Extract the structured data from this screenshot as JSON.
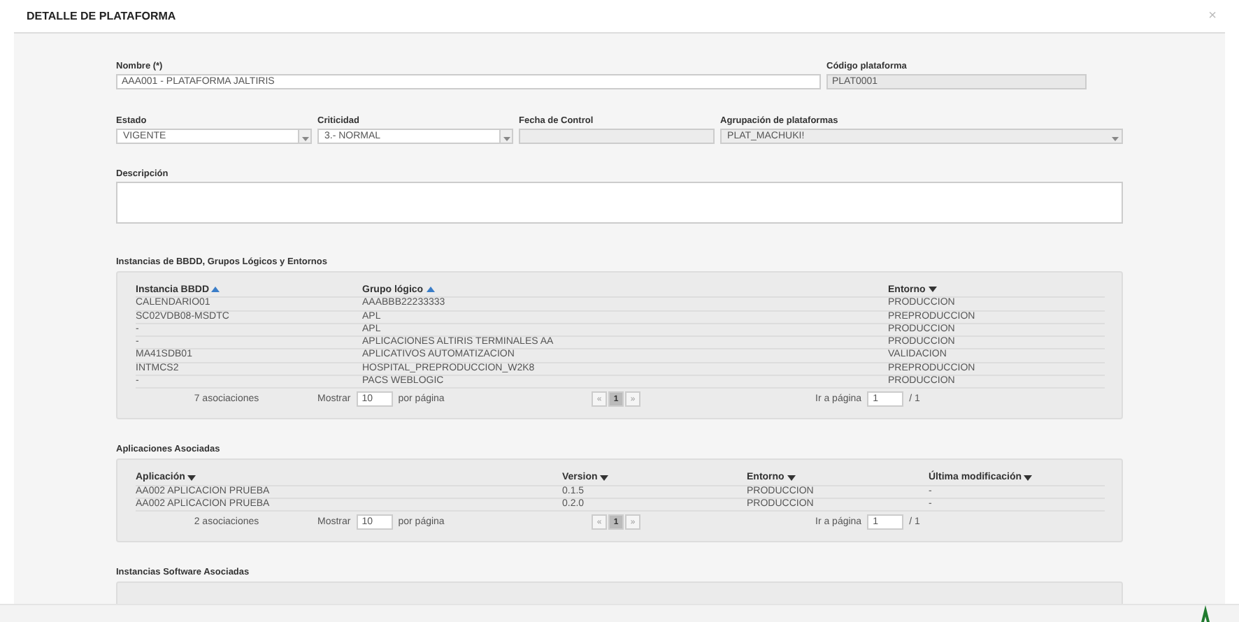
{
  "window": {
    "title": "DETALLE DE PLATAFORMA",
    "close": "×"
  },
  "form": {
    "nombre": {
      "label": "Nombre (*)",
      "value": "AAA001 - PLATAFORMA JALTIRIS"
    },
    "codigo": {
      "label": "Código plataforma",
      "value": "PLAT0001",
      "disabled": true
    },
    "selects": [
      {
        "label": "Estado",
        "value": "VIGENTE",
        "kind": "select"
      },
      {
        "label": "Criticidad",
        "value": "3.- NORMAL",
        "kind": "select"
      },
      {
        "label": "Fecha de Control",
        "kind": "readonly"
      },
      {
        "label": "Agrupación de plataformas",
        "value": "PLAT_MACHUKI!",
        "kind": "wide-select"
      }
    ],
    "descripcion": {
      "label": "Descripción"
    }
  },
  "sections": [
    {
      "title": "Instancias de BBDD, Grupos Lógicos y Entornos",
      "columns": [
        {
          "label": "Instancia BBDD",
          "ascending": true
        },
        {
          "label": "Grupo lógico",
          "ascending": true
        },
        {
          "label": "Entorno",
          "ascending": false
        }
      ],
      "rows": [
        [
          "CALENDARIO01",
          "AAABBB22233333",
          "PRODUCCION"
        ],
        [
          "SC02VDB08-MSDTC",
          "APL",
          "PREPRODUCCION"
        ],
        [
          "-",
          "APL",
          "PRODUCCION"
        ],
        [
          "-",
          "APLICACIONES ALTIRIS TERMINALES AA",
          "PRODUCCION"
        ],
        [
          "MA41SDB01",
          "APLICATIVOS AUTOMATIZACION",
          "VALIDACION"
        ],
        [
          "INTMCS2",
          "HOSPITAL_PREPRODUCCION_W2K8",
          "PREPRODUCCION"
        ],
        [
          "-",
          "PACS WEBLOGIC",
          "PRODUCCION"
        ]
      ],
      "footer": {
        "count": "7 asociaciones",
        "show": "Mostrar",
        "page_size": "10",
        "per_page": "por página",
        "prev": "«",
        "page": "1",
        "next": "»",
        "goto": "Ir a página",
        "goto_value": "1",
        "total": "/ 1"
      }
    },
    {
      "title": "Aplicaciones Asociadas",
      "columns": [
        {
          "label": "Aplicación",
          "ascending": false
        },
        {
          "label": "Version",
          "ascending": false
        },
        {
          "label": "Entorno",
          "ascending": false
        },
        {
          "label": "Última modificación",
          "ascending": false
        }
      ],
      "rows": [
        [
          "AA002 APLICACION PRUEBA",
          "0.1.5",
          "PRODUCCION",
          "-"
        ],
        [
          "AA002 APLICACION PRUEBA",
          "0.2.0",
          "PRODUCCION",
          "-"
        ]
      ],
      "footer": {
        "count": "2 asociaciones",
        "show": "Mostrar",
        "page_size": "10",
        "per_page": "por página",
        "prev": "«",
        "page": "1",
        "next": "»",
        "goto": "Ir a página",
        "goto_value": "1",
        "total": "/ 1"
      }
    },
    {
      "title": "Instancias Software Asociadas"
    }
  ]
}
